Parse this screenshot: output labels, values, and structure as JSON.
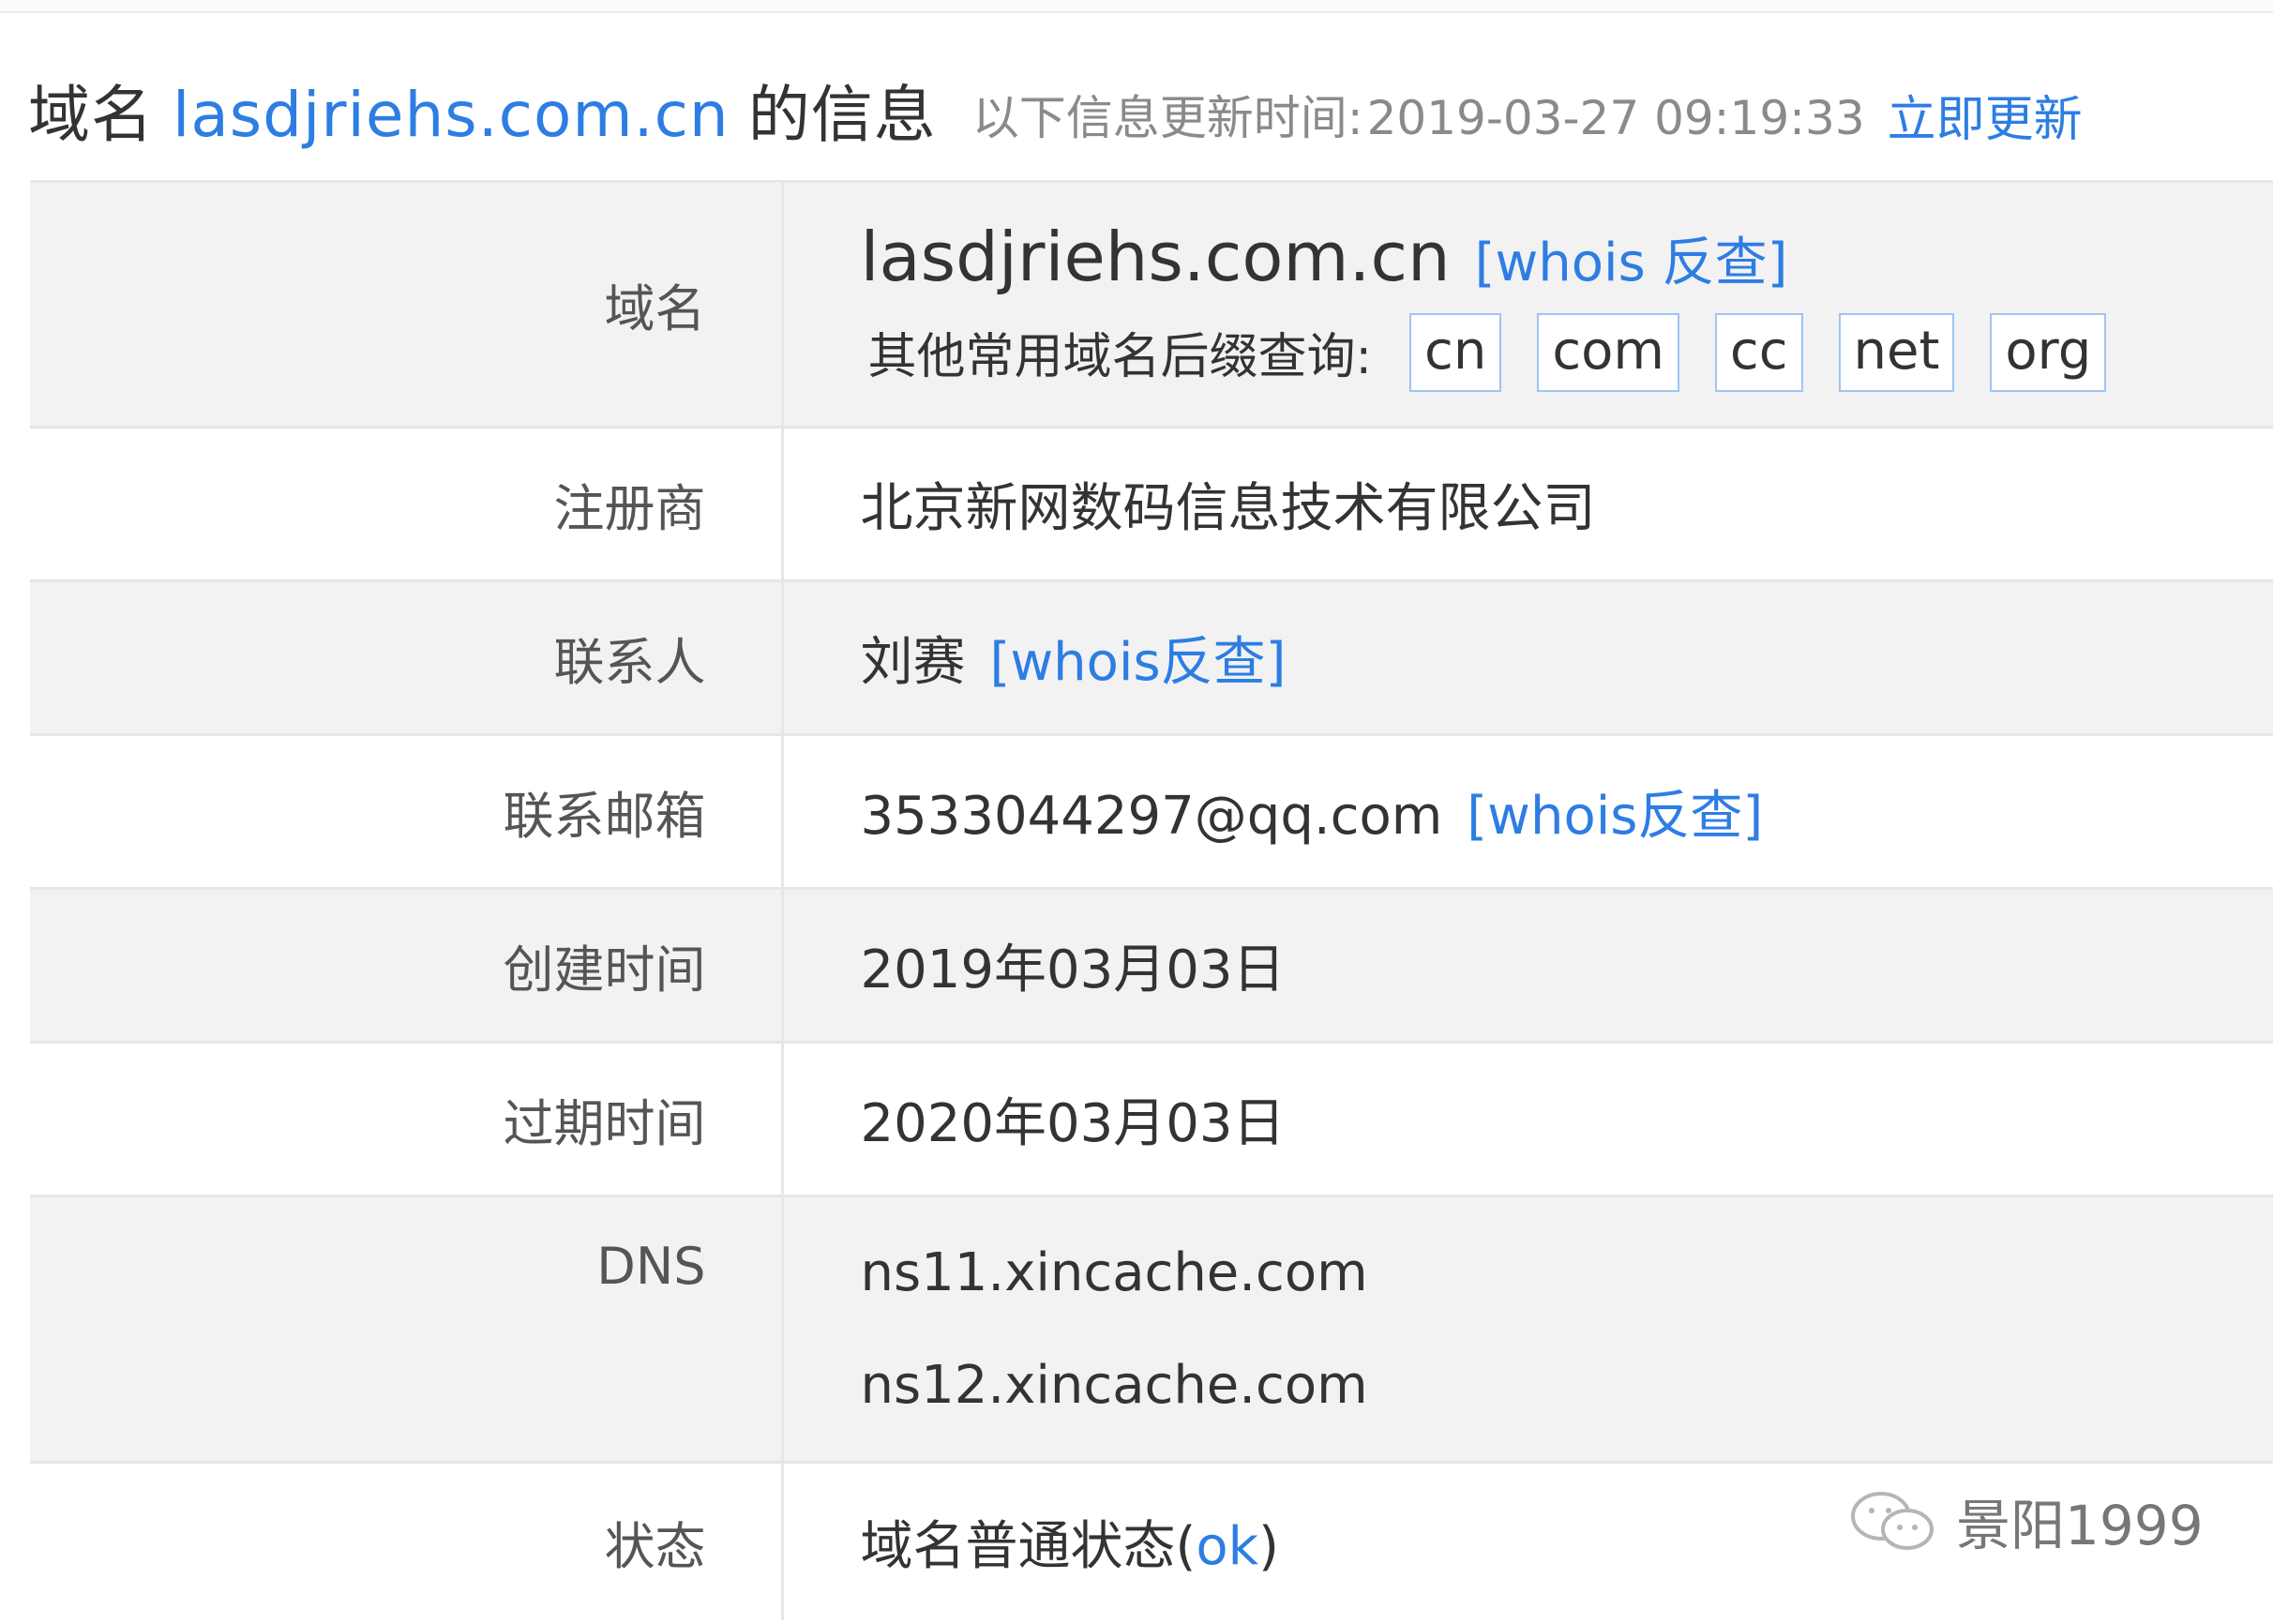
{
  "header": {
    "prefix": "域名",
    "domain": "lasdjriehs.com.cn",
    "suffix": "的信息",
    "updated_label": "以下信息更新时间:",
    "updated_time": "2019-03-27 09:19:33",
    "refresh_label": "立即更新"
  },
  "rows": {
    "domain": {
      "label": "域名",
      "value": "lasdjriehs.com.cn",
      "reverse": "[whois 反查]",
      "suffix_label": "其他常用域名后缀查询:",
      "suffixes": [
        "cn",
        "com",
        "cc",
        "net",
        "org"
      ]
    },
    "registrar": {
      "label": "注册商",
      "value": "北京新网数码信息技术有限公司"
    },
    "contact": {
      "label": "联系人",
      "value": "刘赛",
      "reverse": "[whois反查]"
    },
    "email": {
      "label": "联系邮箱",
      "value": "3533044297@qq.com",
      "reverse": "[whois反查]"
    },
    "created": {
      "label": "创建时间",
      "value": "2019年03月03日"
    },
    "expires": {
      "label": "过期时间",
      "value": "2020年03月03日"
    },
    "dns": {
      "label": "DNS",
      "values": [
        "ns11.xincache.com",
        "ns12.xincache.com"
      ]
    },
    "status": {
      "label": "状态",
      "value": "域名普通状态(",
      "code": "ok",
      "close": ")"
    }
  },
  "watermark": {
    "text": "景阳1999",
    "icon": "wechat-icon"
  },
  "colors": {
    "link": "#2d7de3",
    "row_alt": "#f2f2f2",
    "border": "#e6e6e6"
  }
}
